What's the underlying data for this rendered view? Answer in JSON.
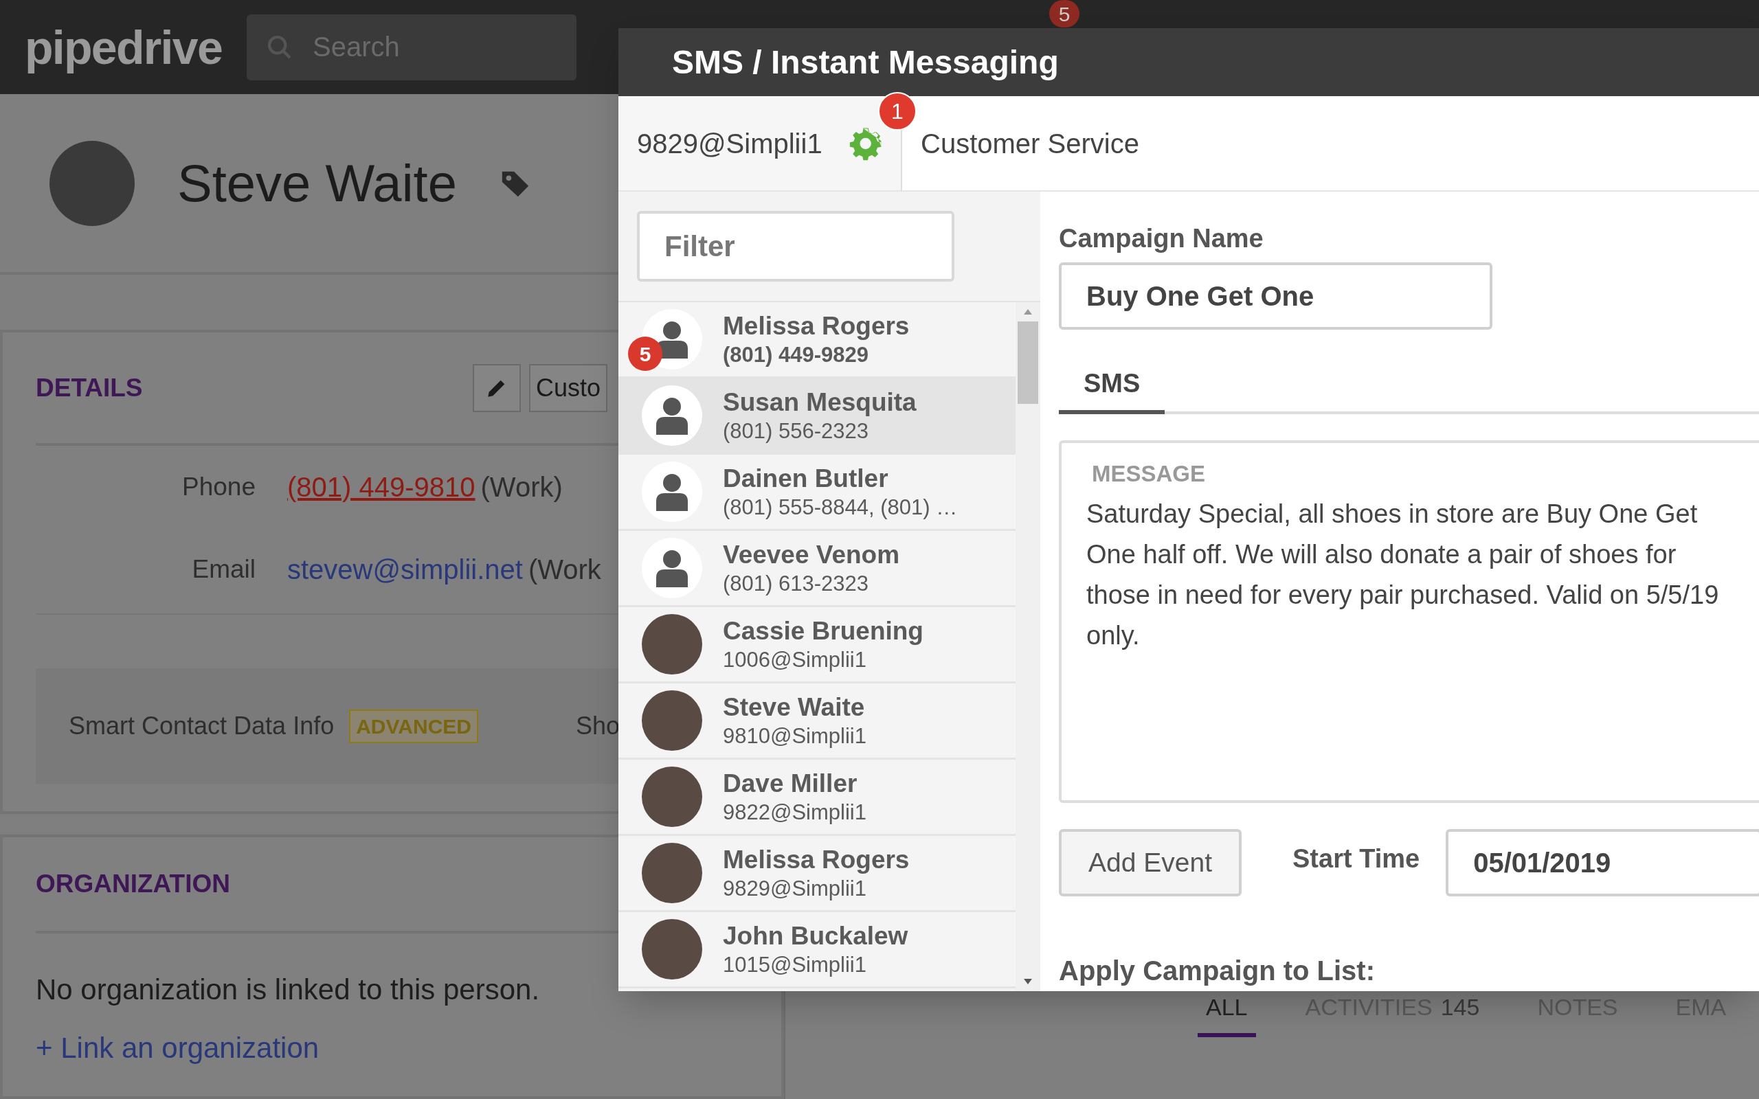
{
  "topbar": {
    "logo": "pipedrive",
    "search": {
      "placeholder": "Search"
    },
    "notification_badge": "5"
  },
  "person": {
    "name": "Steve Waite"
  },
  "details": {
    "title": "DETAILS",
    "customize_button": "Custo",
    "fields": [
      {
        "label": "Phone",
        "value": "(801) 449-9810",
        "kind": "phone",
        "note": "(Work)"
      },
      {
        "label": "Email",
        "value": "stevew@simplii.net",
        "kind": "email",
        "note": "(Work"
      }
    ],
    "smart_contact": {
      "label": "Smart Contact Data Info",
      "badge": "ADVANCED",
      "link": "Sho"
    }
  },
  "organization": {
    "title": "ORGANIZATION",
    "empty_text": "No organization is linked to this person.",
    "link": "+ Link an organization"
  },
  "activity_tabs": [
    {
      "label": "ALL",
      "selected": true
    },
    {
      "label": "ACTIVITIES",
      "count": "145",
      "selected": false
    },
    {
      "label": "NOTES",
      "selected": false
    },
    {
      "label": "EMA",
      "selected": false
    }
  ],
  "modal": {
    "title": "SMS / Instant Messaging",
    "account": "9829@Simplii1",
    "settings_badge": "1",
    "queue": "Customer Service",
    "filter": {
      "placeholder": "Filter"
    },
    "contacts": [
      {
        "name": "Melissa Rogers",
        "detail": "(801) 449-9829",
        "kind": "generic",
        "unread": true,
        "badge": "5",
        "selected": false
      },
      {
        "name": "Susan Mesquita",
        "detail": "(801) 556-2323",
        "kind": "generic",
        "unread": false,
        "selected": true
      },
      {
        "name": "Dainen Butler",
        "detail": "(801) 555-8844, (801) …",
        "kind": "generic",
        "unread": false,
        "selected": false
      },
      {
        "name": "Veevee Venom",
        "detail": "(801) 613-2323",
        "kind": "generic",
        "unread": false,
        "selected": false
      },
      {
        "name": "Cassie Bruening",
        "detail": "1006@Simplii1",
        "kind": "photo",
        "unread": false,
        "selected": false
      },
      {
        "name": "Steve Waite",
        "detail": "9810@Simplii1",
        "kind": "photo",
        "unread": false,
        "selected": false
      },
      {
        "name": "Dave Miller",
        "detail": "9822@Simplii1",
        "kind": "photo",
        "unread": false,
        "selected": false
      },
      {
        "name": "Melissa Rogers",
        "detail": "9829@Simplii1",
        "kind": "photo",
        "unread": false,
        "selected": false
      },
      {
        "name": "John Buckalew",
        "detail": "1015@Simplii1",
        "kind": "photo",
        "unread": false,
        "selected": false
      }
    ],
    "campaign": {
      "name_label": "Campaign Name",
      "name_value": "Buy One Get One",
      "tabs": [
        {
          "label": "SMS",
          "selected": true
        }
      ],
      "message_label": "MESSAGE",
      "message": "Saturday Special, all shoes in store are Buy One Get One half off. We will also donate a pair of shoes for those in need for every pair purchased. Valid on 5/5/19 only.",
      "add_event": "Add Event",
      "start_time_label": "Start Time",
      "start_time": "05/01/2019",
      "apply_label": "Apply Campaign to List:"
    }
  }
}
